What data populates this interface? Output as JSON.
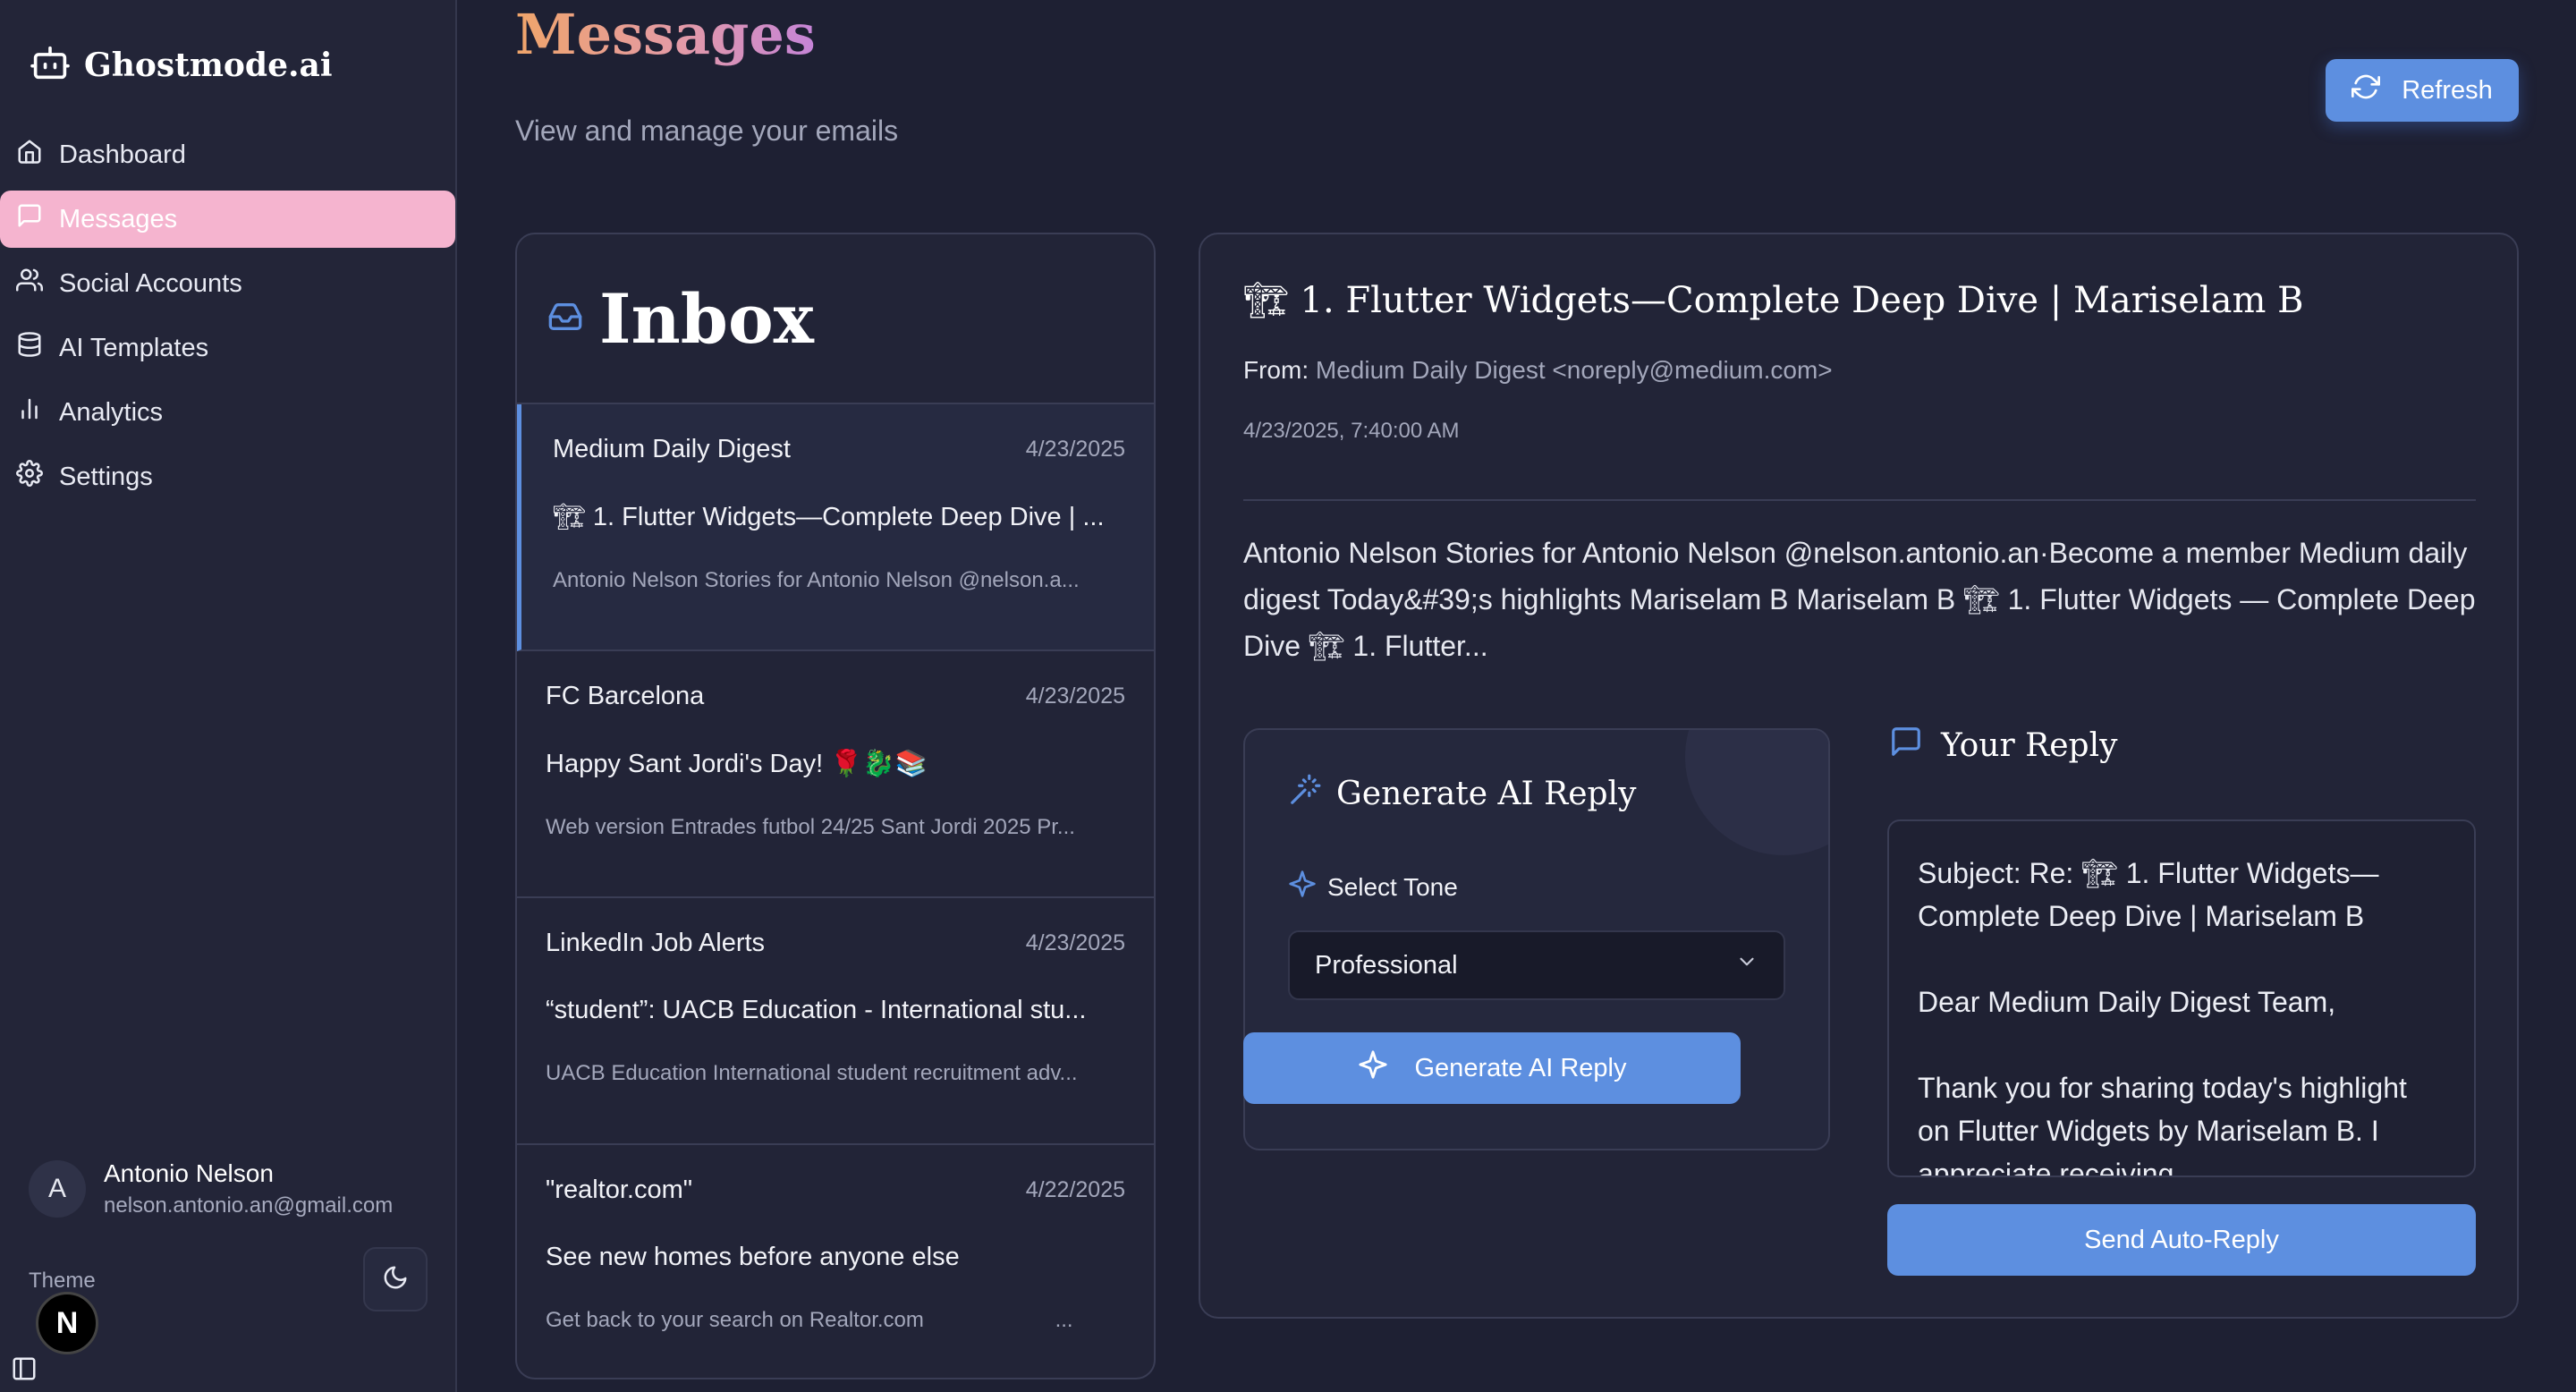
{
  "sidebar": {
    "brand": "Ghostmode.ai",
    "items": [
      {
        "label": "Dashboard",
        "icon": "home-icon"
      },
      {
        "label": "Messages",
        "icon": "message-icon"
      },
      {
        "label": "Social Accounts",
        "icon": "users-icon"
      },
      {
        "label": "AI Templates",
        "icon": "database-icon"
      },
      {
        "label": "Analytics",
        "icon": "bar-chart-icon"
      },
      {
        "label": "Settings",
        "icon": "gear-icon"
      }
    ],
    "active_index": 1,
    "user": {
      "initial": "A",
      "name": "Antonio Nelson",
      "email": "nelson.antonio.an@gmail.com"
    },
    "theme_label": "Theme",
    "badge": "N"
  },
  "header": {
    "title": "Messages",
    "subtitle": "View and manage your emails",
    "refresh_label": "Refresh"
  },
  "inbox": {
    "title": "Inbox",
    "emails": [
      {
        "sender": "Medium Daily Digest",
        "date": "4/23/2025",
        "subject": "🏗 1. Flutter Widgets—Complete Deep Dive | ...",
        "preview": "Antonio Nelson Stories for Antonio Nelson @nelson.a..."
      },
      {
        "sender": "FC Barcelona",
        "date": "4/23/2025",
        "subject": "Happy Sant Jordi's Day! 🌹🐉📚",
        "preview": "Web version Entrades futbol 24/25 Sant Jordi 2025 Pr..."
      },
      {
        "sender": "LinkedIn Job Alerts",
        "date": "4/23/2025",
        "subject": "“student”: UACB Education - International stu...",
        "preview": "UACB Education International student recruitment adv..."
      },
      {
        "sender": "\"realtor.com\"",
        "date": "4/22/2025",
        "subject": "See new homes before anyone else",
        "preview": "Get back to your search on Realtor.com                      ..."
      }
    ]
  },
  "detail": {
    "subject": "🏗 1. Flutter Widgets—Complete Deep Dive | Mariselam B",
    "from_label": "From:",
    "from_value": "Medium Daily Digest <noreply@medium.com>",
    "timestamp": "4/23/2025, 7:40:00 AM",
    "body": "Antonio Nelson Stories for Antonio Nelson @nelson.antonio.an·Become a member Medium daily digest Today&#39;s highlights Mariselam B Mariselam B 🏗 1. Flutter Widgets — Complete Deep Dive 🏗 1. Flutter...",
    "generate": {
      "title": "Generate AI Reply",
      "tone_label": "Select Tone",
      "tone_value": "Professional",
      "button_label": "Generate AI Reply"
    },
    "reply": {
      "title": "Your Reply",
      "text": "Subject: Re: 🏗 1. Flutter Widgets—Complete Deep Dive | Mariselam B\n\nDear Medium Daily Digest Team,\n\nThank you for sharing today's highlight on Flutter Widgets by Mariselam B. I appreciate receiving",
      "send_label": "Send Auto-Reply"
    }
  },
  "colors": {
    "accent": "#5d8fe0",
    "active_nav": "#f5b4cf",
    "background": "#1e2033"
  }
}
